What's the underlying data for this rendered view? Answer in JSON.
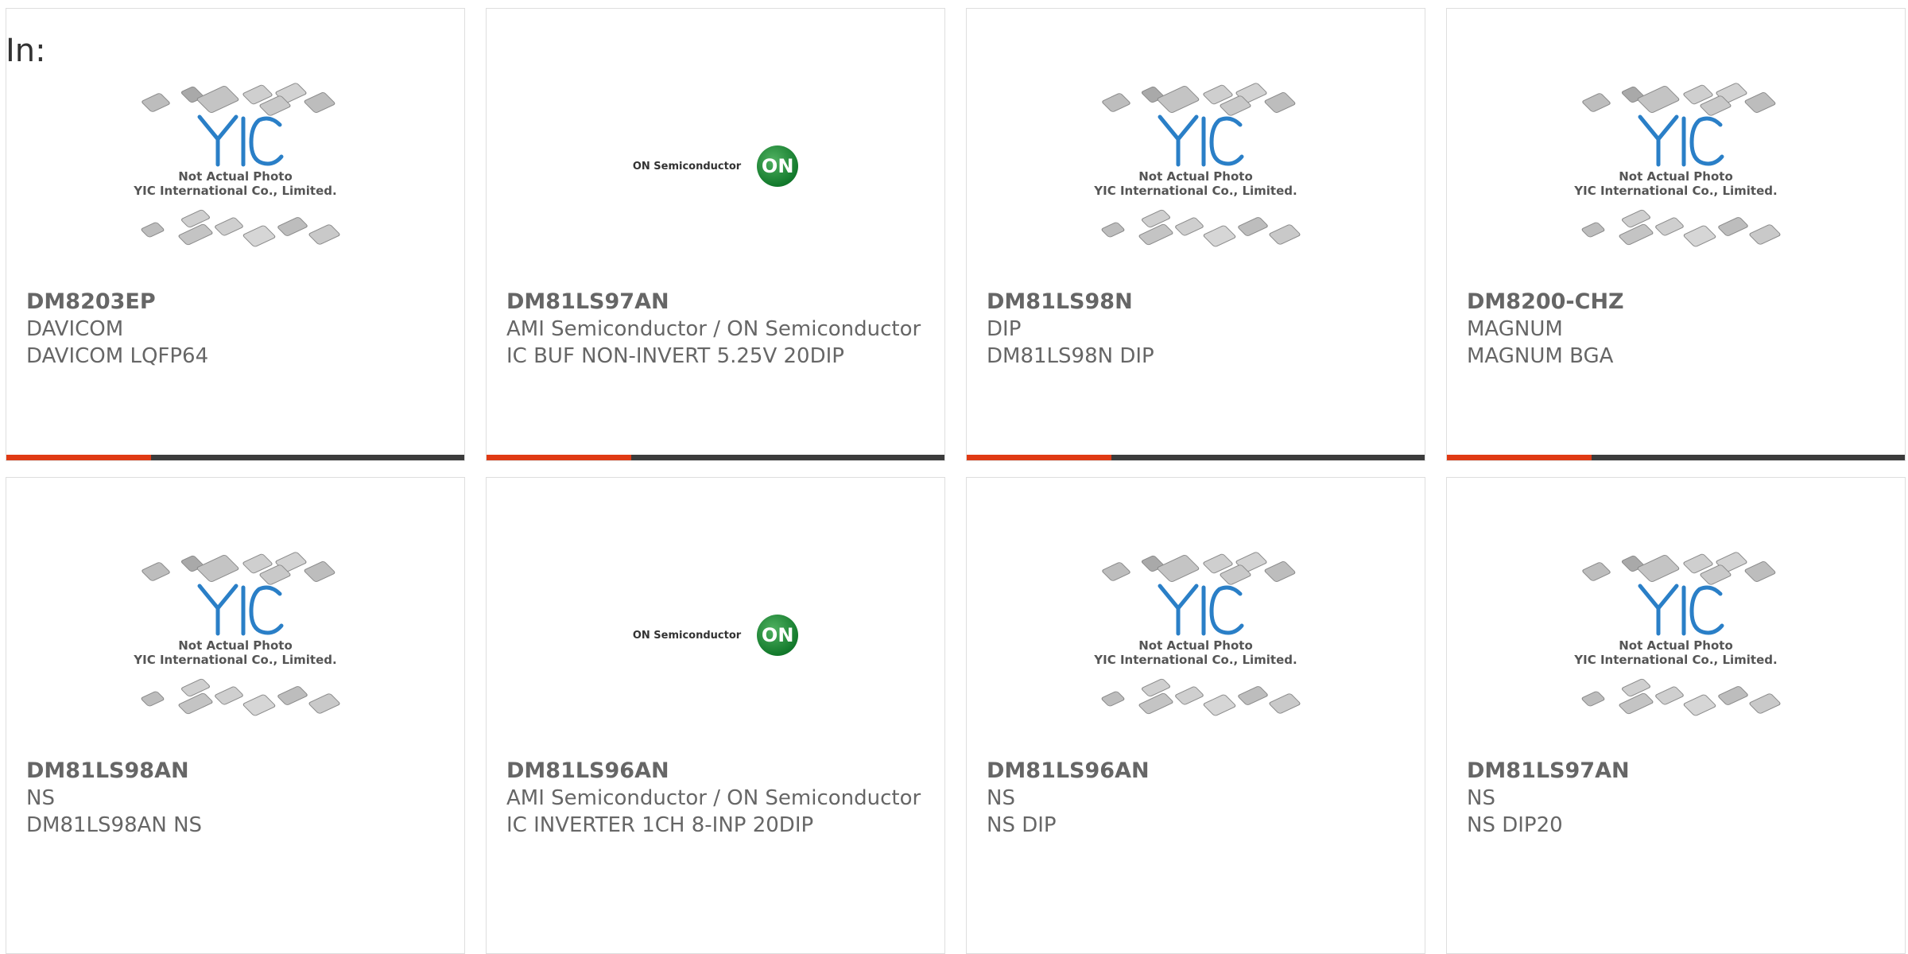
{
  "header": {
    "label": "In:"
  },
  "placeholder": {
    "line1": "Not Actual Photo",
    "line2": "YIC International Co., Limited."
  },
  "on_logo": {
    "text": "ON Semiconductor",
    "badge": "ON"
  },
  "colors": {
    "accent": "#e03a14",
    "bar": "#3c3c3c",
    "text": "#666666",
    "yic_blue": "#2a7fc7"
  },
  "products": [
    {
      "part": "DM8203EP",
      "mfr": "DAVICOM",
      "desc": "DAVICOM LQFP64",
      "image": "yic-placeholder"
    },
    {
      "part": "DM81LS97AN",
      "mfr": "AMI Semiconductor / ON Semiconductor",
      "desc": "IC BUF NON-INVERT 5.25V 20DIP",
      "image": "on-semiconductor-logo"
    },
    {
      "part": "DM81LS98N",
      "mfr": "DIP",
      "desc": "DM81LS98N DIP",
      "image": "yic-placeholder"
    },
    {
      "part": "DM8200-CHZ",
      "mfr": "MAGNUM",
      "desc": "MAGNUM BGA",
      "image": "yic-placeholder"
    },
    {
      "part": "DM81LS98AN",
      "mfr": "NS",
      "desc": "DM81LS98AN NS",
      "image": "yic-placeholder"
    },
    {
      "part": "DM81LS96AN",
      "mfr": "AMI Semiconductor / ON Semiconductor",
      "desc": "IC INVERTER 1CH 8-INP 20DIP",
      "image": "on-semiconductor-logo"
    },
    {
      "part": "DM81LS96AN",
      "mfr": "NS",
      "desc": "NS DIP",
      "image": "yic-placeholder"
    },
    {
      "part": "DM81LS97AN",
      "mfr": "NS",
      "desc": "NS DIP20",
      "image": "yic-placeholder"
    }
  ]
}
